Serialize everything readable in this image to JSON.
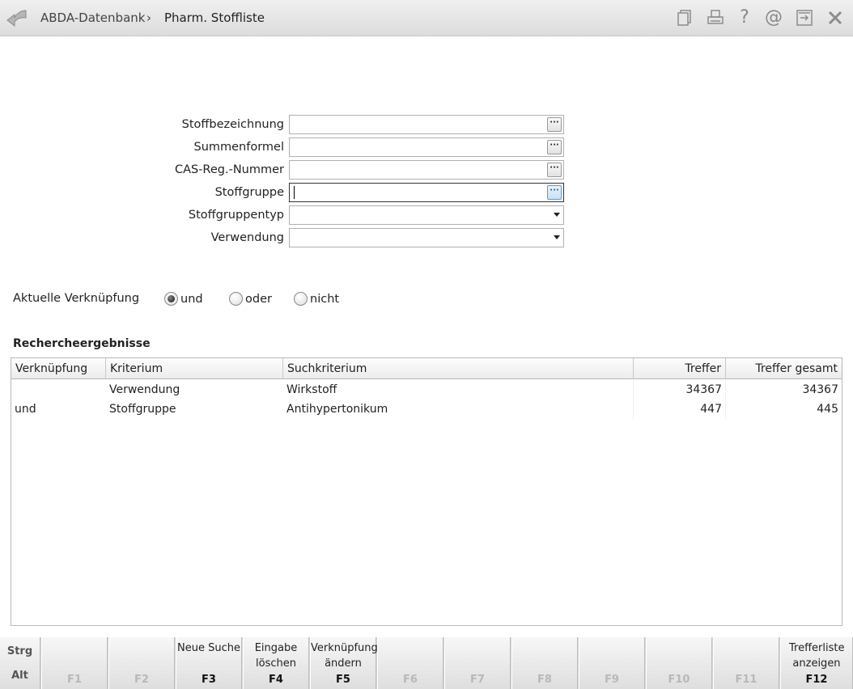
{
  "titlebar": {
    "breadcrumb": [
      "ABDA-Datenbank",
      "Pharm. Stoffliste"
    ],
    "separator": "›",
    "icons": [
      "copy-icon",
      "print-icon",
      "help-icon",
      "at-icon",
      "export-icon",
      "close-icon"
    ]
  },
  "form": {
    "fields": [
      {
        "label": "Stoffbezeichnung",
        "value": "",
        "control": "ellipsis"
      },
      {
        "label": "Summenformel",
        "value": "",
        "control": "ellipsis"
      },
      {
        "label": "CAS-Reg.-Nummer",
        "value": "",
        "control": "ellipsis"
      },
      {
        "label": "Stoffgruppe",
        "value": "",
        "control": "ellipsis",
        "focused": true
      },
      {
        "label": "Stoffgruppentyp",
        "value": "",
        "control": "dropdown"
      },
      {
        "label": "Verwendung",
        "value": "",
        "control": "dropdown"
      }
    ]
  },
  "verknuepfung": {
    "label": "Aktuelle Verknüpfung",
    "options": [
      "und",
      "oder",
      "nicht"
    ],
    "selected": "und"
  },
  "results": {
    "title": "Rechercheergebnisse",
    "columns": [
      "Verknüpfung",
      "Kriterium",
      "Suchkriterium",
      "Treffer",
      "Treffer gesamt"
    ],
    "rows": [
      {
        "verknuepfung": "",
        "kriterium": "Verwendung",
        "suchkriterium": "Wirkstoff",
        "treffer": "34367",
        "gesamt": "34367"
      },
      {
        "verknuepfung": "und",
        "kriterium": "Stoffgruppe",
        "suchkriterium": "Antihypertonikum",
        "treffer": "447",
        "gesamt": "445"
      }
    ]
  },
  "fkeys": {
    "strg": "Strg",
    "alt": "Alt",
    "keys": [
      {
        "key": "F1",
        "label": "",
        "enabled": false
      },
      {
        "key": "F2",
        "label": "",
        "enabled": false
      },
      {
        "key": "F3",
        "label": "Neue Suche",
        "enabled": true
      },
      {
        "key": "F4",
        "label": "Eingabe löschen",
        "enabled": true
      },
      {
        "key": "F5",
        "label": "Verknüpfung ändern",
        "enabled": true
      },
      {
        "key": "F6",
        "label": "",
        "enabled": false
      },
      {
        "key": "F7",
        "label": "",
        "enabled": false
      },
      {
        "key": "F8",
        "label": "",
        "enabled": false
      },
      {
        "key": "F9",
        "label": "",
        "enabled": false
      },
      {
        "key": "F10",
        "label": "",
        "enabled": false
      },
      {
        "key": "F11",
        "label": "",
        "enabled": false
      },
      {
        "key": "F12",
        "label": "Trefferliste anzeigen",
        "enabled": true
      }
    ]
  }
}
